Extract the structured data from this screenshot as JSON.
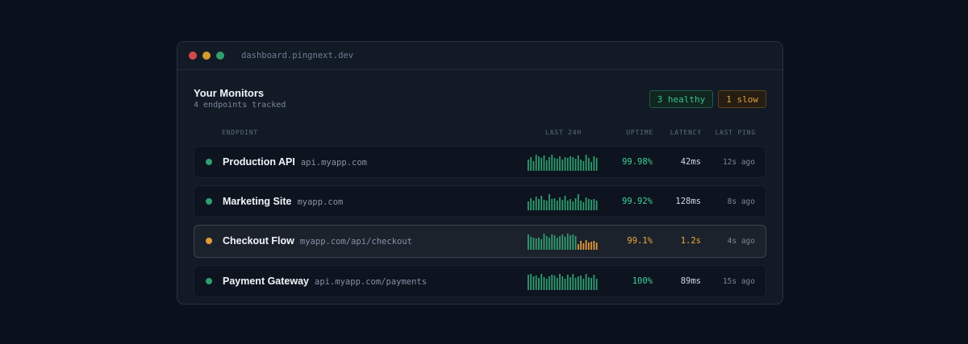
{
  "window": {
    "url": "dashboard.pingnext.dev",
    "dots": [
      "#d14a4a",
      "#d49a2e",
      "#2f9e6f"
    ]
  },
  "header": {
    "title": "Your Monitors",
    "subtitle": "4 endpoints tracked",
    "badges": {
      "healthy": "3 healthy",
      "slow": "1 slow"
    }
  },
  "columns": {
    "endpoint": "ENDPOINT",
    "last24h": "LAST 24H",
    "uptime": "UPTIME",
    "latency": "LATENCY",
    "last_ping": "LAST PING"
  },
  "colors": {
    "ok": "#2f9e6f",
    "ok_text": "#3fd196",
    "warn": "#e39a35",
    "warn_text": "#f0a93b",
    "latency_text": "#d4dae3"
  },
  "monitors": [
    {
      "name": "Production API",
      "host": "api.myapp.com",
      "status": "ok",
      "uptime": "99.98%",
      "latency": "42ms",
      "last_ping": "12s ago",
      "bars": [
        0.7,
        0.85,
        0.6,
        1.0,
        0.9,
        0.8,
        0.95,
        0.65,
        0.85,
        1.0,
        0.8,
        0.75,
        0.9,
        0.7,
        0.85,
        0.8,
        0.9,
        0.85,
        0.75,
        0.95,
        0.7,
        0.6,
        1.0,
        0.8,
        0.55,
        0.9,
        0.8
      ],
      "slow_from": null
    },
    {
      "name": "Marketing Site",
      "host": "myapp.com",
      "status": "ok",
      "uptime": "99.92%",
      "latency": "128ms",
      "last_ping": "8s ago",
      "bars": [
        0.55,
        0.75,
        0.6,
        0.85,
        0.7,
        0.9,
        0.65,
        0.6,
        1.0,
        0.7,
        0.75,
        0.6,
        0.8,
        0.65,
        0.9,
        0.6,
        0.7,
        0.55,
        0.75,
        1.0,
        0.6,
        0.5,
        0.8,
        0.7,
        0.65,
        0.7,
        0.6
      ],
      "slow_from": null
    },
    {
      "name": "Checkout Flow",
      "host": "myapp.com/api/checkout",
      "status": "warn",
      "uptime": "99.1%",
      "latency": "1.2s",
      "last_ping": "4s ago",
      "bars": [
        0.95,
        0.8,
        0.75,
        0.7,
        0.75,
        0.65,
        1.0,
        0.85,
        0.75,
        0.95,
        0.9,
        0.75,
        0.85,
        0.95,
        0.8,
        1.0,
        0.9,
        0.95,
        0.85,
        0.35,
        0.55,
        0.4,
        0.6,
        0.45,
        0.5,
        0.55,
        0.45
      ],
      "slow_from": 19
    },
    {
      "name": "Payment Gateway",
      "host": "api.myapp.com/payments",
      "status": "ok",
      "uptime": "100%",
      "latency": "89ms",
      "last_ping": "15s ago",
      "bars": [
        0.95,
        1.0,
        0.85,
        0.9,
        0.75,
        1.0,
        0.8,
        0.7,
        0.85,
        0.95,
        0.9,
        0.75,
        1.0,
        0.85,
        0.7,
        0.95,
        0.8,
        1.0,
        0.75,
        0.85,
        0.9,
        0.7,
        1.0,
        0.8,
        0.75,
        0.95,
        0.7
      ],
      "slow_from": null
    }
  ]
}
